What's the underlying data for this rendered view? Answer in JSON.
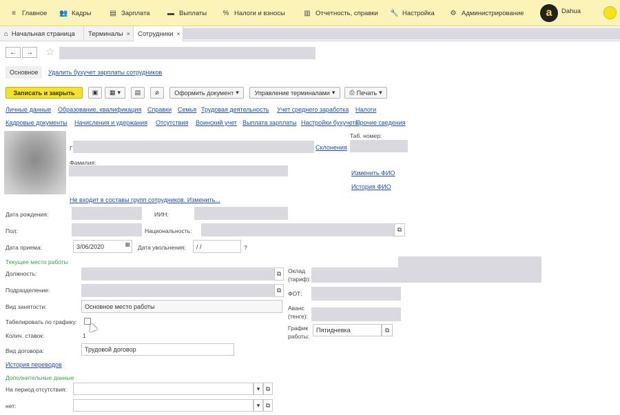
{
  "menu": [
    {
      "label": "Главное",
      "icon": "hamburger-icon",
      "glyph": "≡"
    },
    {
      "label": "Кадры",
      "icon": "people-icon",
      "glyph": "👥"
    },
    {
      "label": "Зарплата",
      "icon": "document-icon",
      "glyph": "▤"
    },
    {
      "label": "Выплаты",
      "icon": "payments-icon",
      "glyph": "▬"
    },
    {
      "label": "Налоги и взносы",
      "icon": "percent-icon",
      "glyph": "%"
    },
    {
      "label": "Отчетность, справки",
      "icon": "report-icon",
      "glyph": "▥"
    },
    {
      "label": "Настройка",
      "icon": "wrench-icon",
      "glyph": "🔧"
    },
    {
      "label": "Администрирование",
      "icon": "gear-icon",
      "glyph": "⚙"
    }
  ],
  "user": {
    "logo_text": "a",
    "name": "Dahua"
  },
  "tabs": [
    {
      "label": "Начальная страница",
      "icon": "home-icon",
      "glyph": "⌂"
    },
    {
      "label": "Терминалы",
      "close": "×"
    },
    {
      "label": "Сотрудники",
      "close": "×"
    }
  ],
  "nav": {
    "back": "←",
    "forward": "→",
    "star": "☆"
  },
  "subtabs": {
    "main": "Основное",
    "link": "Удалить бухучет зарплаты сотрудников"
  },
  "toolbar": {
    "save_close": "Записать и закрыть",
    "arrange_doc": "Оформить документ",
    "manage_terminals": "Управление терминалами",
    "print": "Печать",
    "dropdown": "▾"
  },
  "links_row1": [
    "Личные данные",
    "Образование, квалификация",
    "Справки",
    "Семья",
    "Трудовая деятельность",
    "Учет среднего заработка",
    "Налоги"
  ],
  "links_row2": [
    "Кадровые документы",
    "Начисления и удержания",
    "Отсутствия",
    "Воинский учет",
    "Выплата зарплаты",
    "Настройки бухучета",
    "Прочие сведения"
  ],
  "person": {
    "name_label_fragment": "Г",
    "declension_link": "Склонения",
    "tab_number_label": "Таб. номер:",
    "surname_label": "Фамилия:",
    "change_fio": "Изменить ФИО",
    "fio_history": "История ФИО",
    "groups_link": "Не входит в составы групп сотрудников. Изменить..."
  },
  "fields": {
    "birth_date_label": "Дата рождения:",
    "iin_label": "ИИН:",
    "gender_label": "Пол:",
    "nationality_label": "Национальность:",
    "hire_date_label": "Дата приема:",
    "hire_date_value": "3/06/2020",
    "dismiss_date_label": "Дата увольнения:",
    "dismiss_date_value": "/ /",
    "dismiss_help": "?"
  },
  "workplace": {
    "section": "Текущее место работы",
    "position_label": "Должность:",
    "department_label": "Подразделение:",
    "employment_type_label": "Вид занятости:",
    "employment_type_value": "Основное место работы",
    "schedule_tabulate_label": "Табелировать по графику:",
    "rate_count_label": "Колич. ставок:",
    "rate_count_value": "1",
    "contract_type_label": "Вид договора:",
    "contract_type_value": "Трудовой договор",
    "salary_label_1": "Оклад",
    "salary_label_2": "(тариф):",
    "fot_label": "ФОТ:",
    "advance_label_1": "Аванс",
    "advance_label_2": "(тенге):",
    "schedule_label_1": "График",
    "schedule_label_2": "работы:",
    "schedule_value": "Пятидневка",
    "transfer_history": "История переводов"
  },
  "additional": {
    "section": "Дополнительные данные",
    "absence_label": "На период отсутствия:",
    "other_label": "нет:"
  },
  "colors": {
    "accent": "#f5e22b",
    "link": "#1f4fb0",
    "section": "#3aa04a",
    "topbar": "#fbf3b8"
  }
}
